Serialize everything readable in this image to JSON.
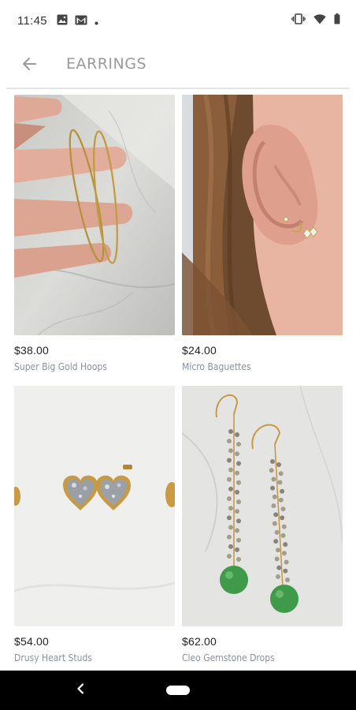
{
  "status_bar": {
    "time": "11:45",
    "left_icons": [
      "image-icon",
      "gmail-icon",
      "dot-icon"
    ],
    "right_icons": [
      "vibrate-icon",
      "wifi-icon",
      "battery-icon"
    ]
  },
  "toolbar": {
    "back_icon": "arrow-back-icon",
    "title": "EARRINGS"
  },
  "products": [
    {
      "price": "$38.00",
      "name": "Super Big Gold Hoops"
    },
    {
      "price": "$24.00",
      "name": "Micro Baguettes"
    },
    {
      "price": "$54.00",
      "name": "Drusy Heart Studs"
    },
    {
      "price": "$62.00",
      "name": "Cleo Gemstone Drops"
    }
  ],
  "nav_bar": {
    "back_icon": "nav-back-icon",
    "home_icon": "nav-home-pill"
  },
  "colors": {
    "title": "#9a9a9a",
    "price": "#222222",
    "product_name": "#8b8fa3",
    "nav_bar": "#000000"
  }
}
